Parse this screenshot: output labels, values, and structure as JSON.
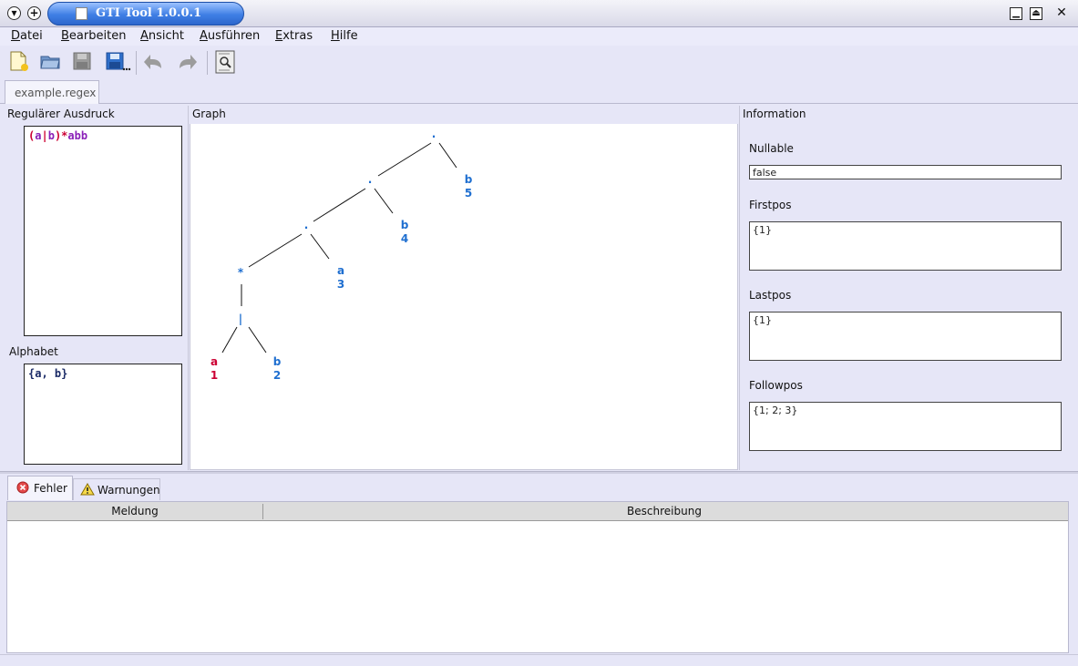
{
  "window": {
    "title": "GTI Tool 1.0.0.1"
  },
  "menu": {
    "items": [
      {
        "first": "D",
        "rest": "atei"
      },
      {
        "first": "B",
        "rest": "earbeiten"
      },
      {
        "first": "A",
        "rest": "nsicht"
      },
      {
        "first": "A",
        "rest": "usführen"
      },
      {
        "first": "E",
        "rest": "xtras"
      },
      {
        "first": "H",
        "rest": "ilfe"
      }
    ]
  },
  "toolbar": {
    "icons": [
      "new-file-icon",
      "open-folder-icon",
      "save-icon",
      "save-as-icon",
      "undo-icon",
      "redo-icon",
      "preview-icon"
    ]
  },
  "tabs": {
    "file": "example.regex"
  },
  "left": {
    "regex_label": "Regulärer Ausdruck",
    "regex": {
      "open": "(",
      "a": "a",
      "bar": "|",
      "b": "b",
      "close": ")",
      "star": "*",
      "rest": "abb"
    },
    "alphabet_label": "Alphabet",
    "alphabet": "{a, b}"
  },
  "graph": {
    "label": "Graph",
    "nodes": [
      {
        "symbol": "·",
        "pos": ""
      },
      {
        "symbol": "·",
        "pos": ""
      },
      {
        "symbol": "·",
        "pos": ""
      },
      {
        "symbol": "*",
        "pos": ""
      },
      {
        "symbol": "|",
        "pos": ""
      },
      {
        "symbol": "b",
        "pos": "5"
      },
      {
        "symbol": "b",
        "pos": "4"
      },
      {
        "symbol": "a",
        "pos": "3"
      },
      {
        "symbol": "a",
        "pos": "1"
      },
      {
        "symbol": "b",
        "pos": "2"
      }
    ]
  },
  "info": {
    "label": "Information",
    "nullable_label": "Nullable",
    "nullable": "false",
    "firstpos_label": "Firstpos",
    "firstpos": "{1}",
    "lastpos_label": "Lastpos",
    "lastpos": "{1}",
    "followpos_label": "Followpos",
    "followpos": "{1; 2; 3}"
  },
  "bottom": {
    "tab_errors": "Fehler",
    "tab_warnings": "Warnungen",
    "col_message": "Meldung",
    "col_description": "Beschreibung"
  },
  "colors": {
    "title_blue": "#3f7fe5",
    "node_blue": "#1f6fd0",
    "node_red": "#cc0033",
    "regex_purple": "#8a1fb8"
  }
}
